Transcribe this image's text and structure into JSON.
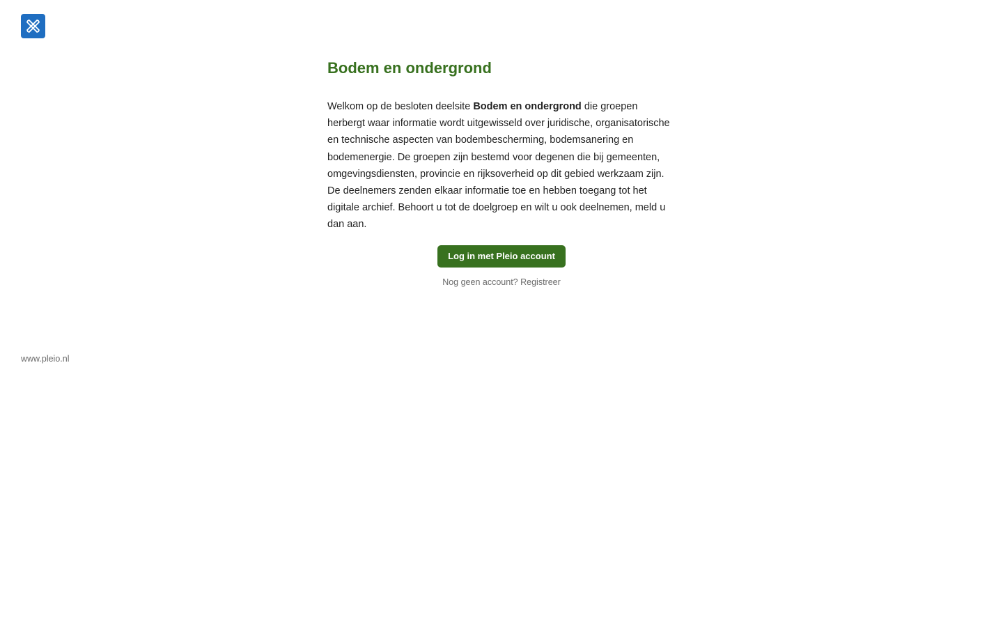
{
  "header": {
    "logo_icon": "pleio-logo-icon",
    "logo_color": "#1f6ec1"
  },
  "main": {
    "title": "Bodem en ondergrond",
    "intro_before": "Welkom op de besloten deelsite ",
    "intro_bold": "Bodem en ondergrond",
    "intro_after": " die groepen herbergt waar informatie wordt uitgewisseld over juridische, organisatorische en technische aspecten van bodembescherming, bodemsanering en bodemenergie. De groepen zijn bestemd voor degenen die bij gemeenten, omgevingsdiensten, provincie en rijksoverheid op dit gebied werkzaam zijn. De deelnemers zenden elkaar informatie toe en hebben toegang tot het digitale archief. Behoort u tot de doelgroep en wilt u ook deelnemen, meld u dan aan.",
    "login_label": "Log in met Pleio account",
    "no_account_text": "Nog geen account?",
    "register_label": "Registreer"
  },
  "footer": {
    "link_text": "www.pleio.nl"
  },
  "colors": {
    "accent_green": "#38711f",
    "muted_text": "#6b6b6b"
  }
}
